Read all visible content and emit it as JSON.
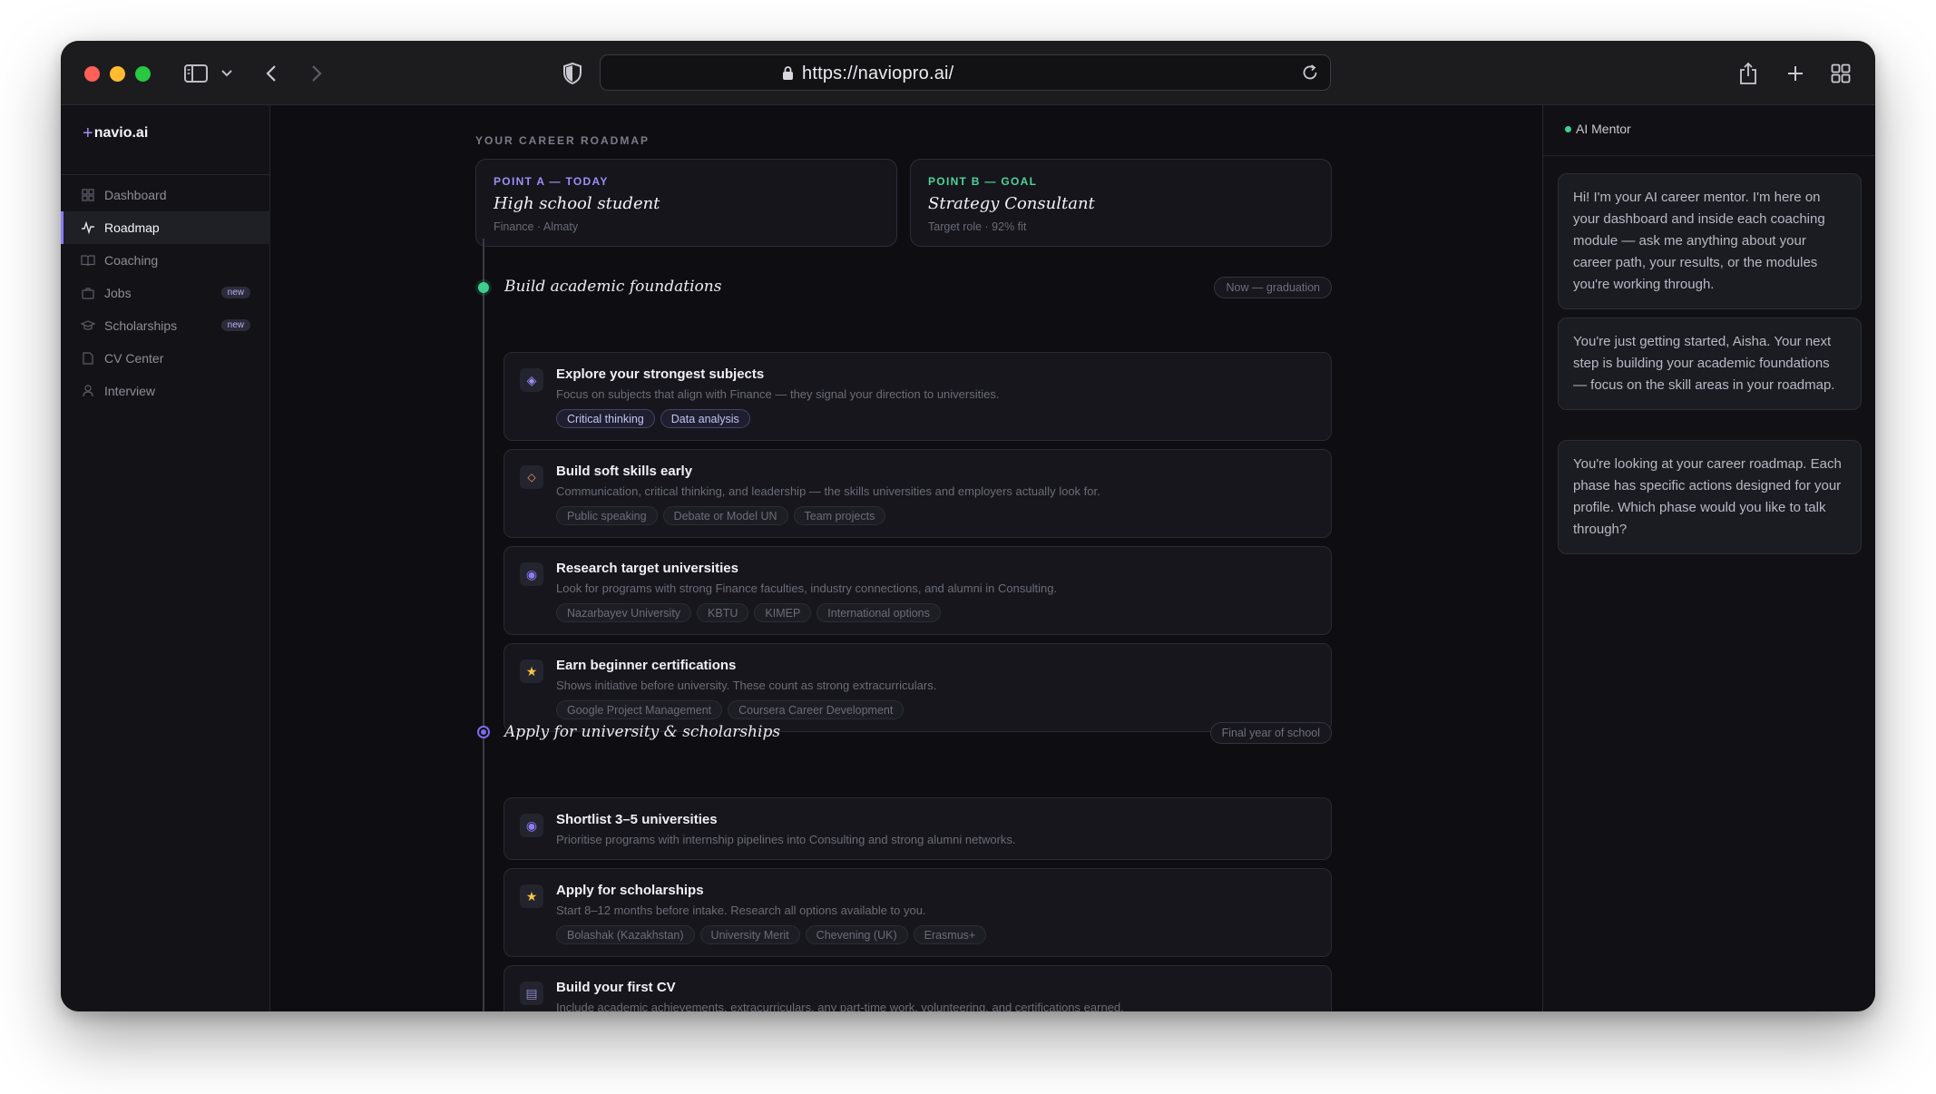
{
  "browser": {
    "url": "https://naviopro.ai/"
  },
  "sidebar": {
    "brand_plus": "+",
    "brand": "navio.ai",
    "items": [
      {
        "label": "Dashboard"
      },
      {
        "label": "Roadmap"
      },
      {
        "label": "Coaching"
      },
      {
        "label": "Jobs",
        "badge": "new"
      },
      {
        "label": "Scholarships",
        "badge": "new"
      },
      {
        "label": "CV Center"
      },
      {
        "label": "Interview"
      }
    ],
    "active": "Roadmap"
  },
  "main": {
    "eyebrow": "YOUR CAREER ROADMAP",
    "point_a": {
      "label": "POINT A — TODAY",
      "title": "High school student",
      "subtitle": "Finance · Almaty"
    },
    "point_b": {
      "label": "POINT B — GOAL",
      "title": "Strategy Consultant",
      "subtitle": "Target role · 92% fit"
    },
    "phases": [
      {
        "title": "Build academic foundations",
        "tag": "Now — graduation",
        "cards": [
          {
            "icon": "◈",
            "title": "Explore your strongest subjects",
            "desc": "Focus on subjects that align with Finance — they signal your direction to universities.",
            "tags": [
              "Critical thinking",
              "Data analysis"
            ]
          },
          {
            "icon": "◇",
            "title": "Build soft skills early",
            "desc": "Communication, critical thinking, and leadership — the skills universities and employers actually look for.",
            "tags": [
              "Public speaking",
              "Debate or Model UN",
              "Team projects"
            ]
          },
          {
            "icon": "◉",
            "title": "Research target universities",
            "desc": "Look for programs with strong Finance faculties, industry connections, and alumni in Consulting.",
            "tags": [
              "Nazarbayev University",
              "KBTU",
              "KIMEP",
              "International options"
            ]
          },
          {
            "icon": "★",
            "title": "Earn beginner certifications",
            "desc": "Shows initiative before university. These count as strong extracurriculars.",
            "tags": [
              "Google Project Management",
              "Coursera Career Development"
            ]
          }
        ]
      },
      {
        "title": "Apply for university & scholarships",
        "tag": "Final year of school",
        "cards": [
          {
            "icon": "◉",
            "title": "Shortlist 3–5 universities",
            "desc": "Prioritise programs with internship pipelines into Consulting and strong alumni networks."
          },
          {
            "icon": "★",
            "title": "Apply for scholarships",
            "desc": "Start 8–12 months before intake. Research all options available to you.",
            "tags": [
              "Bolashak (Kazakhstan)",
              "University Merit",
              "Chevening (UK)",
              "Erasmus+"
            ]
          },
          {
            "icon": "▤",
            "title": "Build your first CV",
            "desc": "Include academic achievements, extracurriculars, any part-time work, volunteering, and certifications earned."
          }
        ]
      }
    ]
  },
  "mentor": {
    "title": "AI Mentor",
    "messages": [
      "Hi! I'm your AI career mentor. I'm here on your dashboard and inside each coaching module — ask me anything about your career path, your results, or the modules you're working through.",
      "You're just getting started, Aisha. Your next step is building your academic foundations — focus on the skill areas in your roadmap.",
      "You're looking at your career roadmap. Each phase has specific actions designed for your profile. Which phase would you like to talk through?"
    ]
  },
  "colors": {
    "accent": "#8b7cf6",
    "point_a_label": "#9d8ff7",
    "point_b_label": "#4fd49a",
    "phase1_dot": "#3ecf8e",
    "phase2_dot": "#7c6cf0",
    "background": "#0e0e12"
  }
}
